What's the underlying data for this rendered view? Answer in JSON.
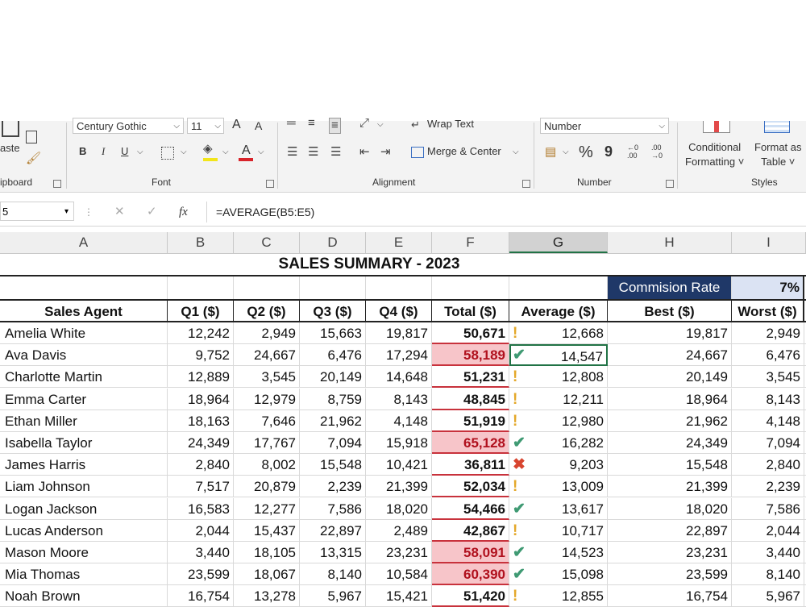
{
  "ribbon": {
    "clipboard": {
      "paste_label": "aste",
      "group_label": "ipboard"
    },
    "font": {
      "font_name": "Century Gothic",
      "font_size": "11",
      "grow_label": "A",
      "shrink_label": "A",
      "bold": "B",
      "italic": "I",
      "underline": "U",
      "font_color_letter": "A",
      "group_label": "Font"
    },
    "alignment": {
      "wrap_text": "Wrap Text",
      "merge_center": "Merge & Center",
      "group_label": "Alignment"
    },
    "number": {
      "format": "Number",
      "percent": "%",
      "comma": "9",
      "increase_decimal": "←0\n.00",
      "decrease_decimal": ".00\n→0",
      "group_label": "Number"
    },
    "styles": {
      "conditional_formatting": "Conditional\nFormatting ˅",
      "format_as_table": "Format as\nTable ˅",
      "group_label": "Styles"
    }
  },
  "formula_bar": {
    "name_box": "5",
    "fx": "fx",
    "formula": "=AVERAGE(B5:E5)"
  },
  "columns": [
    "A",
    "B",
    "C",
    "D",
    "E",
    "F",
    "G",
    "H",
    "I"
  ],
  "sheet": {
    "title": "SALES SUMMARY - 2023",
    "commission_label": "Commision Rate",
    "commission_value": "7%",
    "headers": [
      "Sales Agent",
      "Q1 ($)",
      "Q2 ($)",
      "Q3 ($)",
      "Q4 ($)",
      "Total ($)",
      "Average ($)",
      "Best ($)",
      "Worst ($)"
    ],
    "rows": [
      {
        "name": "Amelia White",
        "q1": "12,242",
        "q2": "2,949",
        "q3": "15,663",
        "q4": "19,817",
        "total": "50,671",
        "status": "warn",
        "highlight": false,
        "avg": "12,668",
        "best": "19,817",
        "worst": "2,949"
      },
      {
        "name": "Ava Davis",
        "q1": "9,752",
        "q2": "24,667",
        "q3": "6,476",
        "q4": "17,294",
        "total": "58,189",
        "status": "ok",
        "highlight": true,
        "avg": "14,547",
        "best": "24,667",
        "worst": "6,476"
      },
      {
        "name": "Charlotte Martin",
        "q1": "12,889",
        "q2": "3,545",
        "q3": "20,149",
        "q4": "14,648",
        "total": "51,231",
        "status": "warn",
        "highlight": false,
        "avg": "12,808",
        "best": "20,149",
        "worst": "3,545"
      },
      {
        "name": "Emma Carter",
        "q1": "18,964",
        "q2": "12,979",
        "q3": "8,759",
        "q4": "8,143",
        "total": "48,845",
        "status": "warn",
        "highlight": false,
        "avg": "12,211",
        "best": "18,964",
        "worst": "8,143"
      },
      {
        "name": "Ethan Miller",
        "q1": "18,163",
        "q2": "7,646",
        "q3": "21,962",
        "q4": "4,148",
        "total": "51,919",
        "status": "warn",
        "highlight": false,
        "avg": "12,980",
        "best": "21,962",
        "worst": "4,148"
      },
      {
        "name": "Isabella Taylor",
        "q1": "24,349",
        "q2": "17,767",
        "q3": "7,094",
        "q4": "15,918",
        "total": "65,128",
        "status": "ok",
        "highlight": true,
        "avg": "16,282",
        "best": "24,349",
        "worst": "7,094"
      },
      {
        "name": "James Harris",
        "q1": "2,840",
        "q2": "8,002",
        "q3": "15,548",
        "q4": "10,421",
        "total": "36,811",
        "status": "bad",
        "highlight": false,
        "avg": "9,203",
        "best": "15,548",
        "worst": "2,840"
      },
      {
        "name": "Liam Johnson",
        "q1": "7,517",
        "q2": "20,879",
        "q3": "2,239",
        "q4": "21,399",
        "total": "52,034",
        "status": "warn",
        "highlight": false,
        "avg": "13,009",
        "best": "21,399",
        "worst": "2,239"
      },
      {
        "name": "Logan Jackson",
        "q1": "16,583",
        "q2": "12,277",
        "q3": "7,586",
        "q4": "18,020",
        "total": "54,466",
        "status": "ok",
        "highlight": false,
        "avg": "13,617",
        "best": "18,020",
        "worst": "7,586"
      },
      {
        "name": "Lucas Anderson",
        "q1": "2,044",
        "q2": "15,437",
        "q3": "22,897",
        "q4": "2,489",
        "total": "42,867",
        "status": "warn",
        "highlight": false,
        "avg": "10,717",
        "best": "22,897",
        "worst": "2,044"
      },
      {
        "name": "Mason Moore",
        "q1": "3,440",
        "q2": "18,105",
        "q3": "13,315",
        "q4": "23,231",
        "total": "58,091",
        "status": "ok",
        "highlight": true,
        "avg": "14,523",
        "best": "23,231",
        "worst": "3,440"
      },
      {
        "name": "Mia Thomas",
        "q1": "23,599",
        "q2": "18,067",
        "q3": "8,140",
        "q4": "10,584",
        "total": "60,390",
        "status": "ok",
        "highlight": true,
        "avg": "15,098",
        "best": "23,599",
        "worst": "8,140"
      },
      {
        "name": "Noah Brown",
        "q1": "16,754",
        "q2": "13,278",
        "q3": "5,967",
        "q4": "15,421",
        "total": "51,420",
        "status": "warn",
        "highlight": false,
        "avg": "12,855",
        "best": "16,754",
        "worst": "5,967"
      }
    ]
  },
  "status_icons": {
    "warn": "exclamation-icon",
    "ok": "checkmark-icon",
    "bad": "cross-icon"
  },
  "colors": {
    "highlight_bg": "#f7c5c9",
    "highlight_text": "#b0101d",
    "commission_bg": "#1f3868",
    "commission_value_bg": "#dbe3f3",
    "selection": "#217346"
  }
}
